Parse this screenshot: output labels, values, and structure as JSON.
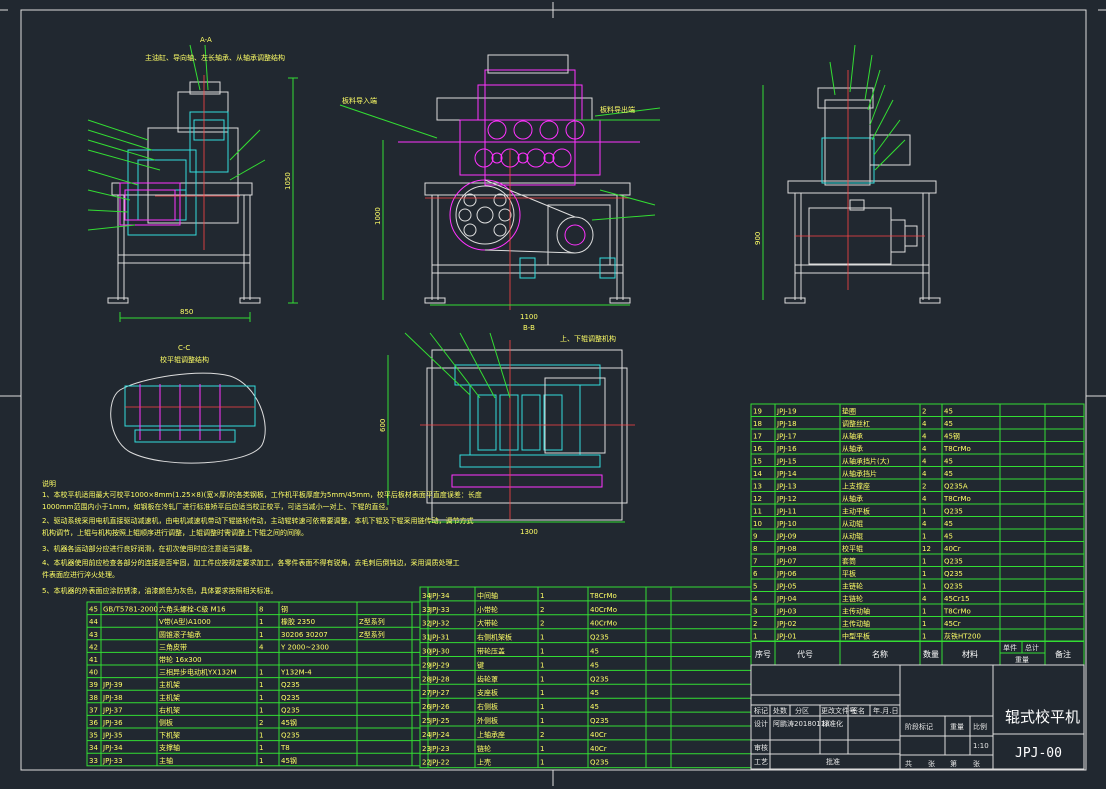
{
  "title_block": {
    "machine_name": "辊式校平机",
    "drawing_code": "JPJ-00",
    "scale": "1:10",
    "stage_label": "阶段标记",
    "weight_label": "重量",
    "scale_label": "比例",
    "sheets_total": "共",
    "sheets_unit": "张",
    "sheet_no_label": "第",
    "sheet_unit2": "张",
    "designer_row": [
      "标记",
      "处数",
      "分区",
      "更改文件号",
      "签名",
      "年.月.日"
    ],
    "design_row": [
      "设计",
      "阿鹏涛20180118",
      "标准化"
    ],
    "review": "审核",
    "process": "工艺",
    "approve": "批准"
  },
  "view_labels": {
    "front_view_title": "B-B",
    "section_a": "A-A",
    "section_b_label": "B-B",
    "section_c": "C-C",
    "section_c_note": "校平辊调整结构",
    "left_note": "主油缸、导向轴、左长轴承、从轴承调整结构",
    "right_top_note": "C-C",
    "inlet_label": "板料导入端",
    "outlet_label": "板料导出端",
    "plan_note": "上、下辊调整机构"
  },
  "dimensions": {
    "left_width": "850",
    "left_height": "1050",
    "front_height": "1000",
    "front_width": "1100",
    "right_height": "900",
    "plan_width": "1300",
    "plan_height": "600"
  },
  "notes": {
    "heading": "说明",
    "lines": [
      "1、本校平机适用最大可校平1000×8mm(1.25×8)(宽×厚)的各类钢板，工作机平板厚度为5mm/45mm，校平后板材表面平直度误差：长度",
      "1000mm范围内小于1mm，如钢板在冷轧厂进行标准矫平后应适当校正校平，可适当减小一对上、下辊的直径。",
      "2、驱动系统采用电机直接驱动减速机，由电机减速机带动下辊链轮传动，主动辊转速可依需要调整，本机下辊及下辊采用链传动，调节方式",
      "机构调节，上辊与机构按照上辊顺序进行调整，上辊调整时需调整上下辊之间的间隙。",
      "3、机器各运动部分应进行良好润滑，在初次使用时应注意适当调整。",
      "4、本机器使用前应检查各部分的连接是否牢固，加工件应按规定要求加工，各零件表面不得有锐角，去毛刺后倒钝边，采用调质处理工",
      "件表面应进行淬火处理。",
      "5、本机器的外表面应涂防锈漆，油漆颜色为灰色，具体要求按照相关标准。"
    ]
  },
  "bom_header": [
    "序号",
    "代号",
    "名称",
    "数量",
    "材料",
    "单件",
    "总计",
    "备注"
  ],
  "bom_weight_label": "重量",
  "bom_right": [
    [
      "19",
      "JPJ-19",
      "垫圈",
      "2",
      "45",
      ""
    ],
    [
      "18",
      "JPJ-18",
      "调整丝杠",
      "4",
      "45",
      ""
    ],
    [
      "17",
      "JPJ-17",
      "从轴承",
      "4",
      "45钢",
      ""
    ],
    [
      "16",
      "JPJ-16",
      "从轴承",
      "4",
      "T8CrMo",
      ""
    ],
    [
      "15",
      "JPJ-15",
      "从轴承挡片(大)",
      "4",
      "45",
      ""
    ],
    [
      "14",
      "JPJ-14",
      "从轴承挡片",
      "4",
      "45",
      ""
    ],
    [
      "13",
      "JPJ-13",
      "上支撑座",
      "2",
      "Q235A",
      ""
    ],
    [
      "12",
      "JPJ-12",
      "从轴承",
      "4",
      "T8CrMo",
      ""
    ],
    [
      "11",
      "JPJ-11",
      "主动平板",
      "1",
      "Q235",
      ""
    ],
    [
      "10",
      "JPJ-10",
      "从动辊",
      "4",
      "45",
      ""
    ],
    [
      "9",
      "JPJ-09",
      "从动辊",
      "1",
      "45",
      ""
    ],
    [
      "8",
      "JPJ-08",
      "校平辊",
      "12",
      "40Cr",
      ""
    ],
    [
      "7",
      "JPJ-07",
      "套筒",
      "1",
      "Q235",
      ""
    ],
    [
      "6",
      "JPJ-06",
      "平板",
      "1",
      "Q235",
      ""
    ],
    [
      "5",
      "JPJ-05",
      "主链轮",
      "1",
      "Q235",
      ""
    ],
    [
      "4",
      "JPJ-04",
      "主链轮",
      "4",
      "45Cr15",
      ""
    ],
    [
      "3",
      "JPJ-03",
      "主传动轴",
      "1",
      "T8CrMo",
      ""
    ],
    [
      "2",
      "JPJ-02",
      "主传动轴",
      "1",
      "45Cr",
      ""
    ],
    [
      "1",
      "JPJ-01",
      "中型平板",
      "1",
      "灰铁HT200"
    ]
  ],
  "bom_middle": [
    [
      "34",
      "JPJ-34",
      "中间轴",
      "1",
      "T8CrMo"
    ],
    [
      "33",
      "JPJ-33",
      "小带轮",
      "2",
      "40CrMo"
    ],
    [
      "32",
      "JPJ-32",
      "大带轮",
      "2",
      "40CrMo"
    ],
    [
      "31",
      "JPJ-31",
      "右侧机架板",
      "1",
      "Q235"
    ],
    [
      "30",
      "JPJ-30",
      "带轮压盖",
      "1",
      "45"
    ],
    [
      "29",
      "JPJ-29",
      "键",
      "1",
      "45"
    ],
    [
      "28",
      "JPJ-28",
      "齿轮罩",
      "1",
      "Q235"
    ],
    [
      "27",
      "JPJ-27",
      "支座板",
      "1",
      "45"
    ],
    [
      "26",
      "JPJ-26",
      "右侧板",
      "1",
      "45"
    ],
    [
      "25",
      "JPJ-25",
      "外侧板",
      "1",
      "Q235"
    ],
    [
      "24",
      "JPJ-24",
      "上轴承座",
      "2",
      "40Cr"
    ],
    [
      "23",
      "JPJ-23",
      "链轮",
      "1",
      "40Cr"
    ],
    [
      "22",
      "JPJ-22",
      "上壳",
      "1",
      "Q235"
    ]
  ],
  "bom_left": [
    [
      "45",
      "GB/T5781-2000",
      "六角头螺栓-C级 M16",
      "8",
      "钢",
      ""
    ],
    [
      "44",
      "",
      "V带(A型)A1000",
      "1",
      "橡胶 2350",
      "Z型系列"
    ],
    [
      "43",
      "",
      "圆锥滚子轴承",
      "1",
      "30206 30207",
      "Z型系列"
    ],
    [
      "42",
      "",
      "三角皮带",
      "4",
      "Y 2000~2300",
      ""
    ],
    [
      "41",
      "",
      "带轮 16x300",
      "",
      "",
      ""
    ],
    [
      "40",
      "",
      "三相异步电动机YX132M",
      "1",
      "Y132M-4",
      ""
    ],
    [
      "39",
      "JPJ-39",
      "主机架",
      "1",
      "Q235",
      ""
    ],
    [
      "38",
      "JPJ-38",
      "主机架",
      "1",
      "Q235",
      ""
    ],
    [
      "37",
      "JPJ-37",
      "右机架",
      "1",
      "Q235",
      ""
    ],
    [
      "36",
      "JPJ-36",
      "侧板",
      "2",
      "45钢",
      ""
    ],
    [
      "35",
      "JPJ-35",
      "下机架",
      "1",
      "Q235",
      ""
    ],
    [
      "34",
      "JPJ-34",
      "支撑轴",
      "1",
      "T8",
      ""
    ],
    [
      "33",
      "JPJ-33",
      "主轴",
      "1",
      "45钢",
      ""
    ]
  ],
  "colors": {
    "background": "#212830",
    "frame": "#dddddd",
    "table": "#33dd33",
    "magenta": "#ff33ff",
    "cyan": "#33dddd",
    "yellow": "#ffff44"
  }
}
